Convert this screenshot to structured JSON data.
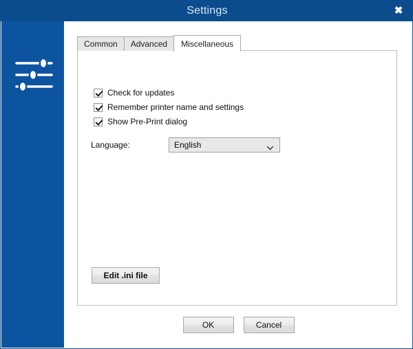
{
  "window": {
    "title": "Settings",
    "close_label": "✖",
    "titlebar_color": "#0b4c8c",
    "sidebar_color": "#0d54a0"
  },
  "sidebar": {
    "icon_name": "sliders-settings-icon"
  },
  "tabs": [
    {
      "label": "Common",
      "active": false
    },
    {
      "label": "Advanced",
      "active": false
    },
    {
      "label": "Miscellaneous",
      "active": true
    }
  ],
  "panel": {
    "checkboxes": [
      {
        "label": "Check for updates",
        "checked": true
      },
      {
        "label": "Remember printer name and settings",
        "checked": true
      },
      {
        "label": "Show Pre-Print dialog",
        "checked": true
      }
    ],
    "language": {
      "label": "Language:",
      "value": "English",
      "options": [
        "English"
      ]
    },
    "edit_ini_label": "Edit .ini file"
  },
  "footer": {
    "ok_label": "OK",
    "cancel_label": "Cancel"
  }
}
